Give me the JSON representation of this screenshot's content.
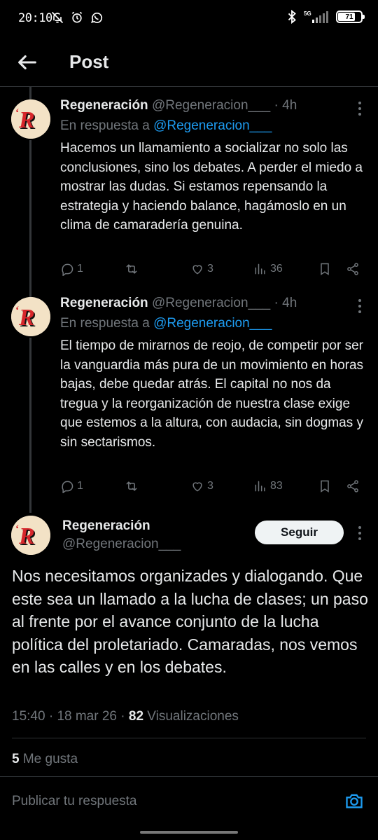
{
  "status_bar": {
    "time": "20:10",
    "network": "5G",
    "battery": "71",
    "battery_level": 0.71
  },
  "header": {
    "title": "Post"
  },
  "replies": [
    {
      "name": "Regeneración",
      "handle": "@Regeneracion___",
      "time": "4h",
      "in_reply_label": "En respuesta a",
      "in_reply_to": "@Regeneracion___",
      "text": "Hacemos un llamamiento a socializar no solo las conclusiones, sino los debates. A perder el miedo a mostrar las dudas. Si estamos repensando la estrategia y haciendo balance, hagámoslo en un clima de camaradería genuina.",
      "replies": "1",
      "reposts": "",
      "likes": "3",
      "views": "36"
    },
    {
      "name": "Regeneración",
      "handle": "@Regeneracion___",
      "time": "4h",
      "in_reply_label": "En respuesta a",
      "in_reply_to": "@Regeneracion___",
      "text": "El tiempo de mirarnos de reojo, de competir por ser la vanguardia más pura de un movimiento en horas bajas, debe quedar atrás. El capital no nos da tregua y la reorganización de nuestra clase exige que estemos a la altura, con audacia, sin dogmas y sin sectarismos.",
      "replies": "1",
      "reposts": "",
      "likes": "3",
      "views": "83"
    }
  ],
  "main_post": {
    "name": "Regeneración",
    "handle": "@Regeneracion___",
    "follow_label": "Seguir",
    "text": "Nos necesitamos organizades y dialogando. Que este sea un llamado a la lucha de clases; un paso al frente por el avance conjunto de la lucha política del proletariado. Camaradas, nos vemos en las calles y en los debates.",
    "time": "15:40",
    "date": "18 mar 26",
    "views_count": "82",
    "views_label": "Visualizaciones",
    "likes_count": "5",
    "likes_label": "Me gusta"
  },
  "composer": {
    "placeholder": "Publicar tu respuesta"
  },
  "colors": {
    "background": "#000000",
    "text": "#e7e9ea",
    "muted": "#71767b",
    "accent": "#1d9bf0",
    "divider": "#2f3336",
    "avatar_bg": "#f3e2c6",
    "avatar_red": "#d7262b"
  },
  "icons": [
    "back-arrow-icon",
    "silent-bell-icon",
    "alarm-icon",
    "whatsapp-icon",
    "bluetooth-icon",
    "signal-icon",
    "reply-icon",
    "repost-icon",
    "like-icon",
    "views-icon",
    "bookmark-icon",
    "share-icon",
    "more-icon",
    "camera-icon"
  ]
}
